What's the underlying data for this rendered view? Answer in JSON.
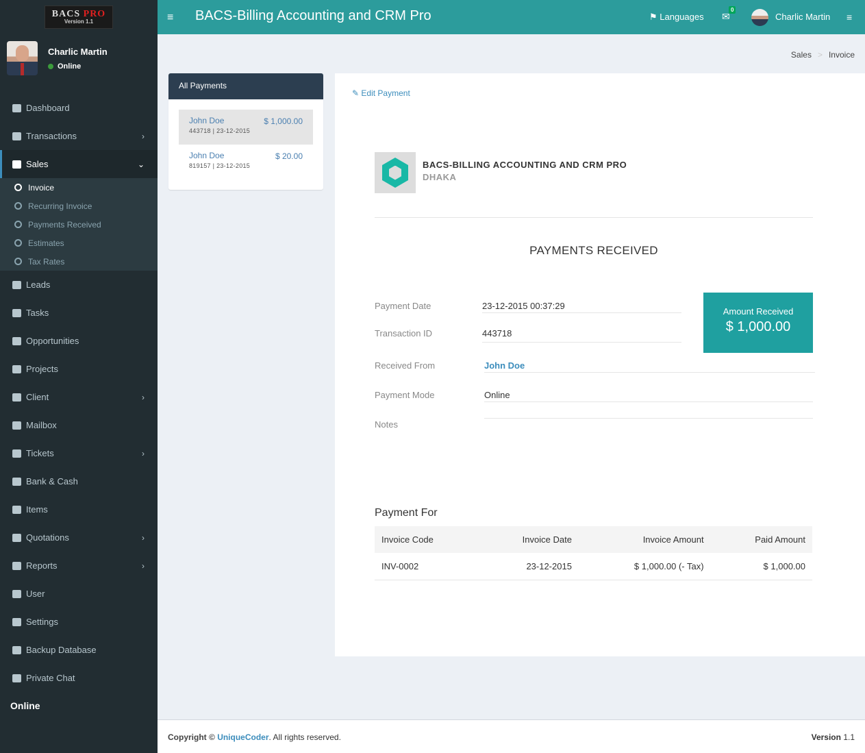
{
  "sidebar": {
    "logo": {
      "line1": "BACS",
      "line1b": "PRO",
      "line2": "Version 1.1"
    },
    "user": {
      "name": "Charlic Martin",
      "status": "Online"
    },
    "menu": [
      {
        "label": "Dashboard",
        "icon": "dashboard-icon"
      },
      {
        "label": "Transactions",
        "icon": "transactions-icon",
        "chevron": "›"
      },
      {
        "label": "Sales",
        "icon": "cart-icon",
        "chevron": "⌄"
      },
      {
        "label": "Leads",
        "icon": "rocket-icon"
      },
      {
        "label": "Tasks",
        "icon": "tasks-icon"
      },
      {
        "label": "Opportunities",
        "icon": "filter-icon"
      },
      {
        "label": "Projects",
        "icon": "folder-icon"
      },
      {
        "label": "Client",
        "icon": "users-icon",
        "chevron": "›"
      },
      {
        "label": "Mailbox",
        "icon": "envelope-icon"
      },
      {
        "label": "Tickets",
        "icon": "ticket-icon",
        "chevron": "›"
      },
      {
        "label": "Bank & Cash",
        "icon": "money-icon"
      },
      {
        "label": "Items",
        "icon": "cube-icon"
      },
      {
        "label": "Quotations",
        "icon": "copy-icon",
        "chevron": "›"
      },
      {
        "label": "Reports",
        "icon": "bar-chart-icon",
        "chevron": "›"
      },
      {
        "label": "User",
        "icon": "user-group-icon"
      },
      {
        "label": "Settings",
        "icon": "gears-icon"
      },
      {
        "label": "Backup Database",
        "icon": "database-icon"
      },
      {
        "label": "Private Chat",
        "icon": "chat-icon"
      }
    ],
    "sales_submenu": [
      "Invoice",
      "Recurring Invoice",
      "Payments Received",
      "Estimates",
      "Tax Rates"
    ],
    "online_label": "Online"
  },
  "header": {
    "toggle": "≡",
    "title": "BACS-Billing Accounting and CRM Pro",
    "languages": "Languages",
    "mail_badge": "0",
    "user_name": "Charlic Martin",
    "menu": "≡"
  },
  "breadcrumb": {
    "parent": "Sales",
    "sep": ">",
    "current": "Invoice"
  },
  "payments_panel": {
    "title": "All Payments",
    "items": [
      {
        "name": "John Doe",
        "amount": "$ 1,000.00",
        "sub": "443718 | 23-12-2015"
      },
      {
        "name": "John Doe",
        "amount": "$ 20.00",
        "sub": "819157 | 23-12-2015"
      }
    ]
  },
  "payment": {
    "edit_label": "Edit Payment",
    "company_name": "BACS-BILLING ACCOUNTING AND CRM PRO",
    "company_city": "DHAKA",
    "doc_title": "PAYMENTS RECEIVED",
    "fields": {
      "date_label": "Payment Date",
      "date_value": "23-12-2015 00:37:29",
      "txn_label": "Transaction ID",
      "txn_value": "443718",
      "from_label": "Received From",
      "from_value": "John Doe",
      "mode_label": "Payment Mode",
      "mode_value": "Online",
      "notes_label": "Notes"
    },
    "amount_box": {
      "title": "Amount Received",
      "value": "$ 1,000.00"
    },
    "payment_for_title": "Payment For",
    "table": {
      "headers": [
        "Invoice Code",
        "Invoice Date",
        "Invoice Amount",
        "Paid Amount"
      ],
      "rows": [
        [
          "INV-0002",
          "23-12-2015",
          "$ 1,000.00 (- Tax)",
          "$ 1,000.00"
        ]
      ]
    }
  },
  "footer": {
    "copyright": "Copyright ©",
    "brand": "UniqueCoder",
    "rights": ". All rights reserved.",
    "version_label": "Version",
    "version": "1.1"
  }
}
